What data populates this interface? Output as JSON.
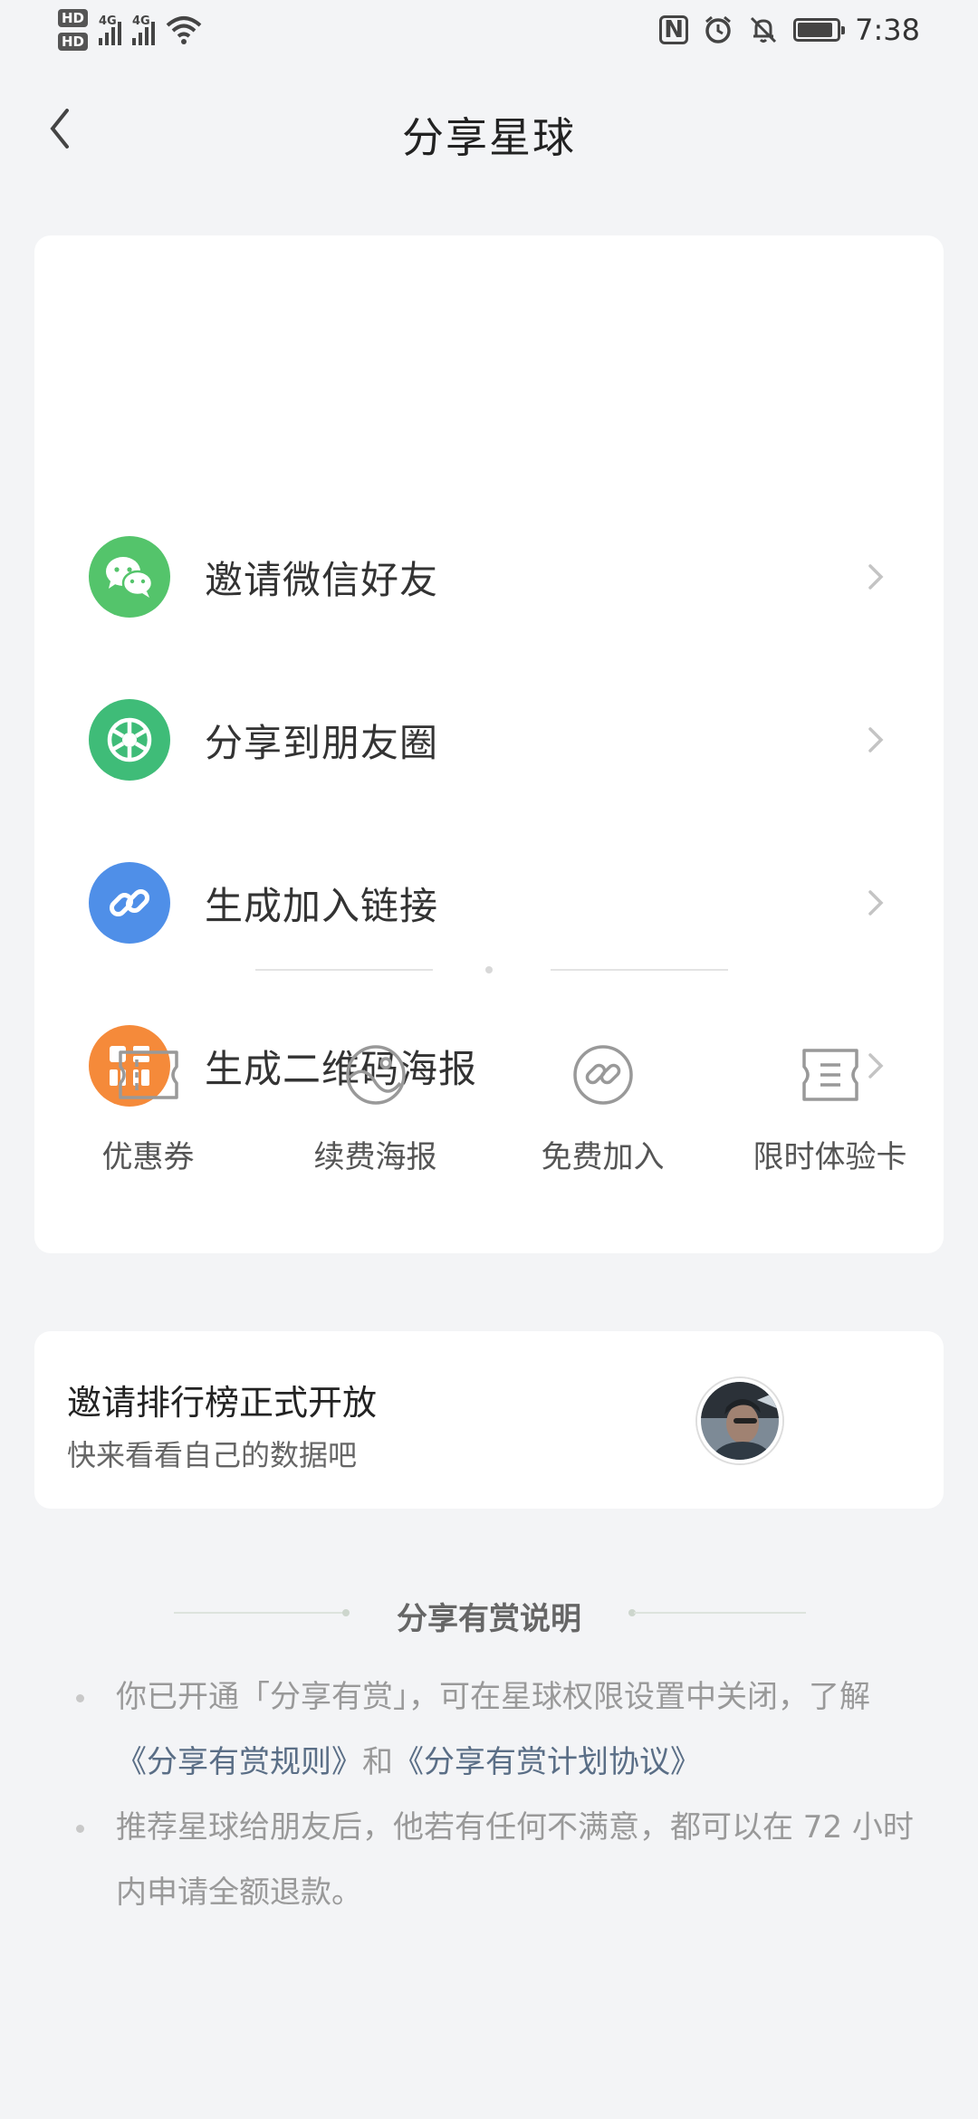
{
  "status_bar": {
    "hd1": "HD",
    "hd2": "HD",
    "net1": "4G",
    "net2": "4G",
    "time": "7:38",
    "battery_level": 0.9,
    "icons": [
      "wifi-icon",
      "nfc-icon",
      "alarm-icon",
      "mute-icon",
      "battery-icon"
    ]
  },
  "nav": {
    "title": "分享星球",
    "back_icon": "chevron-left-icon"
  },
  "share_options": [
    {
      "label": "邀请微信好友",
      "icon": "wechat-icon",
      "color": "#54c46b"
    },
    {
      "label": "分享到朋友圈",
      "icon": "moments-icon",
      "color": "#3fbc78"
    },
    {
      "label": "生成加入链接",
      "icon": "link-icon",
      "color": "#4f8fe8"
    },
    {
      "label": "生成二维码海报",
      "icon": "qrcode-icon",
      "color": "#f58a3a"
    }
  ],
  "tools": [
    {
      "label": "优惠券",
      "icon": "coupon-icon"
    },
    {
      "label": "续费海报",
      "icon": "renew-poster-icon"
    },
    {
      "label": "免费加入",
      "icon": "free-join-icon"
    },
    {
      "label": "限时体验卡",
      "icon": "trial-card-icon"
    }
  ],
  "ranking": {
    "title": "邀请排行榜正式开放",
    "subtitle": "快来看看自己的数据吧"
  },
  "rules": {
    "title": "分享有赏说明",
    "item1_text": "你已开通「分享有赏」，可在星球权限设置中关闭，了解",
    "item1_link1": "《分享有赏规则》",
    "item1_and": "和",
    "item1_link2": "《分享有赏计划协议》",
    "item2_text": "推荐星球给朋友后，他若有任何不满意，都可以在 72 小时内申请全额退款。"
  },
  "colors": {
    "background": "#f3f4f6",
    "card": "#ffffff",
    "link": "#5a6e86"
  }
}
